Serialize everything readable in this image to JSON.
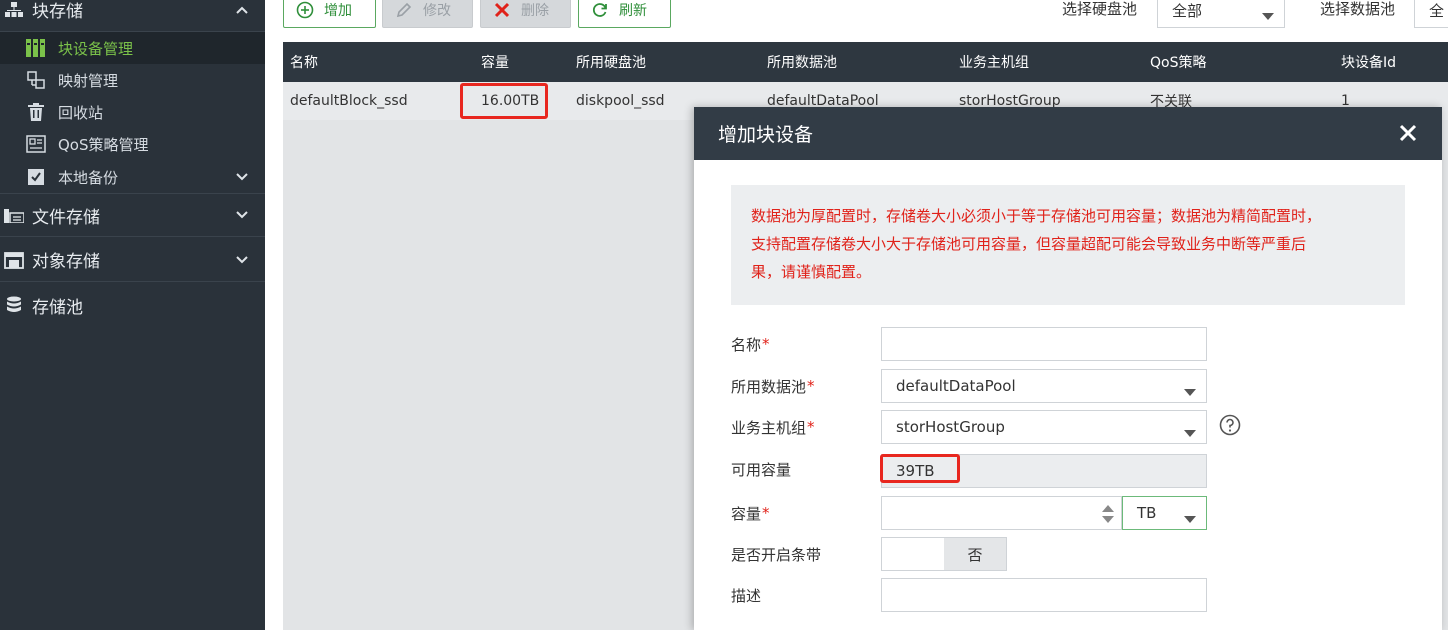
{
  "sidebar": {
    "block_storage": {
      "label": "块存储",
      "icon": "block-storage-icon"
    },
    "items": [
      {
        "label": "块设备管理",
        "icon": "block-device-icon",
        "active": true
      },
      {
        "label": "映射管理",
        "icon": "mapping-icon"
      },
      {
        "label": "回收站",
        "icon": "trash-icon"
      },
      {
        "label": "QoS策略管理",
        "icon": "qos-icon"
      },
      {
        "label": "本地备份",
        "icon": "backup-icon"
      }
    ],
    "file_storage": {
      "label": "文件存储",
      "icon": "file-storage-icon"
    },
    "object_storage": {
      "label": "对象存储",
      "icon": "object-storage-icon"
    },
    "storage_pool": {
      "label": "存储池",
      "icon": "database-icon"
    }
  },
  "toolbar": {
    "add_label": "增加",
    "edit_label": "修改",
    "delete_label": "删除",
    "refresh_label": "刷新"
  },
  "filters": {
    "disk_pool_label": "选择硬盘池",
    "disk_pool_value": "全部",
    "data_pool_label": "选择数据池",
    "data_pool_value": "全"
  },
  "table": {
    "columns": [
      "名称",
      "容量",
      "所用硬盘池",
      "所用数据池",
      "业务主机组",
      "QoS策略",
      "块设备Id"
    ],
    "rows": [
      [
        "defaultBlock_ssd",
        "16.00TB",
        "diskpool_ssd",
        "defaultDataPool",
        "storHostGroup",
        "不关联",
        "1"
      ]
    ]
  },
  "modal": {
    "title": "增加块设备",
    "warning_lines": [
      "数据池为厚配置时，存储卷大小必须小于等于存储池可用容量；数据池为精简配置时，",
      "支持配置存储卷大小大于存储池可用容量，但容量超配可能会导致业务中断等严重后",
      "果，请谨慎配置。"
    ],
    "fields": {
      "name_label": "名称",
      "name_value": "",
      "data_pool_label": "所用数据池",
      "data_pool_value": "defaultDataPool",
      "host_group_label": "业务主机组",
      "host_group_value": "storHostGroup",
      "available_label": "可用容量",
      "available_value": "39TB",
      "capacity_label": "容量",
      "capacity_value": "",
      "capacity_unit": "TB",
      "stripe_label": "是否开启条带",
      "stripe_value": "否",
      "desc_label": "描述",
      "desc_value": "",
      "required_mark": "*"
    }
  },
  "colors": {
    "sidebar_bg": "#2a323a",
    "accent_green": "#7bc24a",
    "highlight_red": "#e8271f",
    "warning_red": "#e0221a"
  }
}
